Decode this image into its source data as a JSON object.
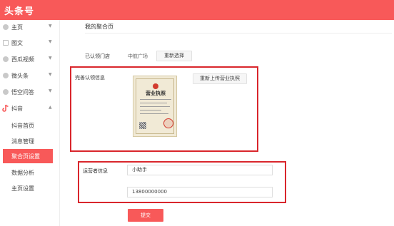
{
  "app": {
    "logo_text": "头条号"
  },
  "sidebar": {
    "items": [
      {
        "label": "主页",
        "icon": "home-icon"
      },
      {
        "label": "图文",
        "icon": "article-icon"
      },
      {
        "label": "西瓜视频",
        "icon": "video-icon"
      },
      {
        "label": "微头条",
        "icon": "micro-post-icon"
      },
      {
        "label": "悟空问答",
        "icon": "qa-icon"
      },
      {
        "label": "抖音",
        "icon": "douyin-icon"
      }
    ],
    "douyin_sub": [
      {
        "label": "抖音首页"
      },
      {
        "label": "消息管理"
      },
      {
        "label": "聚合页设置"
      },
      {
        "label": "数据分析"
      },
      {
        "label": "主页设置"
      }
    ]
  },
  "main": {
    "page_title": "我的聚合页",
    "store": {
      "label": "已认领门店",
      "value": "中航广场",
      "reselect_button": "重新选择"
    },
    "license": {
      "label": "完善认领信息",
      "image_title": "营业执照",
      "reupload_button": "重新上传营业执照"
    },
    "operator": {
      "label": "运营者信息",
      "name_value": "小助手",
      "phone_value": "13800000000"
    },
    "submit_button": "提交"
  },
  "colors": {
    "brand": "#f85959",
    "highlight_border": "#d9262c"
  }
}
